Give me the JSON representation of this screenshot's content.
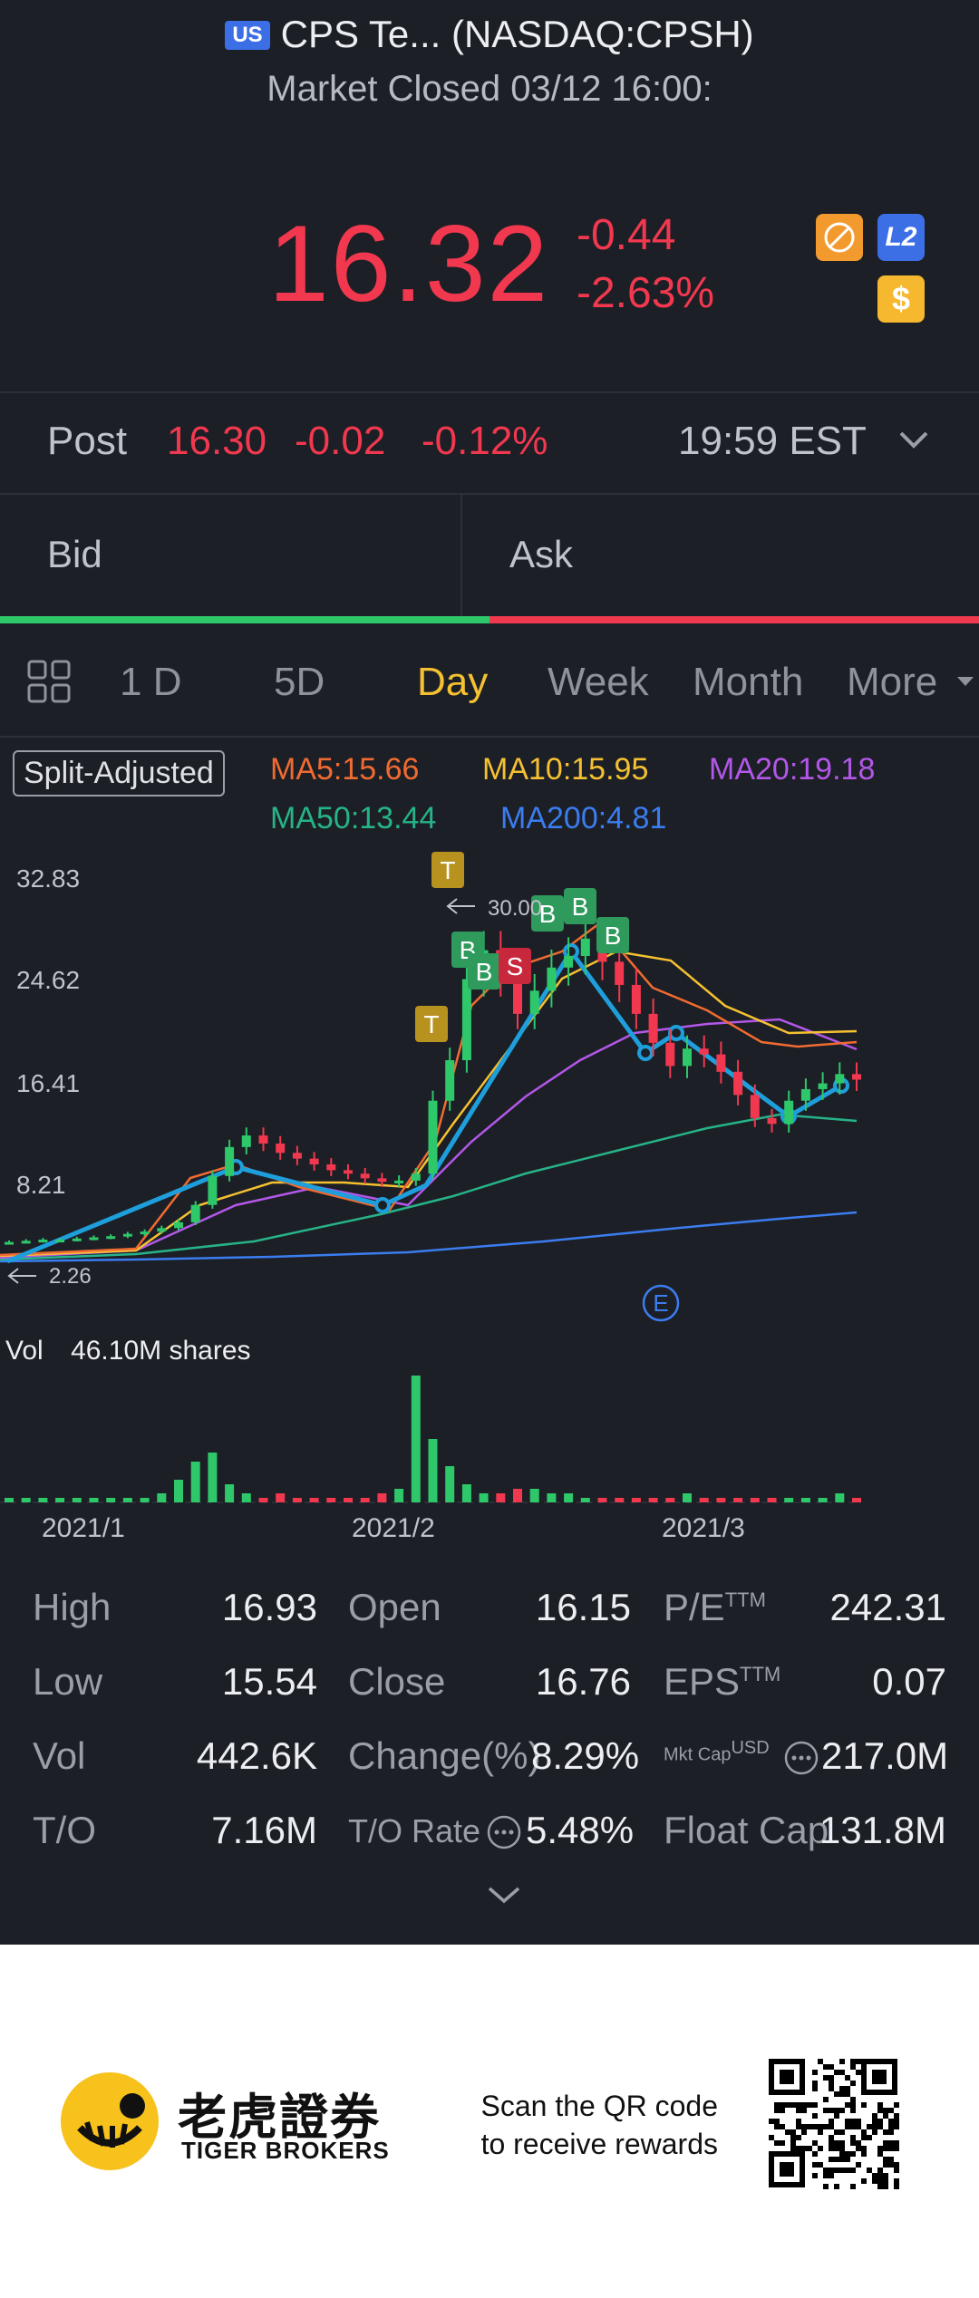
{
  "header": {
    "market_badge": "US",
    "title": "CPS Te... (NASDAQ:CPSH)",
    "status": "Market Closed 03/12 16:00:"
  },
  "quote": {
    "price": "16.32",
    "change": "-0.44",
    "change_pct": "-2.63%",
    "badge_l2": "L2",
    "badge_dollar": "$"
  },
  "post": {
    "label": "Post",
    "price": "16.30",
    "change": "-0.02",
    "change_pct": "-0.12%",
    "time": "19:59 EST"
  },
  "orderbook": {
    "bid": "Bid",
    "ask": "Ask"
  },
  "tabs": [
    "1 D",
    "5D",
    "Day",
    "Week",
    "Month",
    "More"
  ],
  "active_tab": "Day",
  "chart": {
    "adjust_label": "Split-Adjusted",
    "ma5": "MA5:15.66",
    "ma10": "MA10:15.95",
    "ma20": "MA20:19.18",
    "ma50": "MA50:13.44",
    "ma200": "MA200:4.81",
    "y_labels": [
      "32.83",
      "24.62",
      "16.41",
      "8.21"
    ],
    "low_marker": "2.26",
    "high_marker": "30.00",
    "earnings_marker": "E",
    "volume_label": "Vol",
    "volume_value": "46.10M shares",
    "x_labels": [
      "2021/1",
      "2021/2",
      "2021/3"
    ],
    "colors": {
      "up": "#2ec86b",
      "down": "#f2384f",
      "ma5": "#f06b31",
      "ma10": "#f5c131",
      "ma20": "#b357e8",
      "ma50": "#26b38a",
      "ma200": "#3b7df0",
      "trend": "#1e9fdc"
    }
  },
  "chart_data": {
    "type": "candlestick",
    "price_series_approx": [
      2.3,
      2.4,
      2.5,
      2.5,
      2.6,
      2.7,
      2.8,
      3.0,
      3.2,
      3.5,
      4.0,
      5.5,
      8.0,
      10.5,
      11.5,
      10.8,
      10.0,
      9.5,
      9.0,
      8.5,
      8.2,
      7.8,
      7.5,
      7.6,
      8.2,
      14.5,
      18.0,
      25.0,
      27.5,
      25.0,
      22.0,
      24.0,
      26.0,
      27.0,
      28.5,
      26.5,
      24.5,
      22.0,
      19.5,
      17.5,
      19.0,
      18.5,
      17.0,
      15.0,
      13.0,
      12.5,
      14.5,
      15.5,
      16.0,
      16.8,
      16.32
    ],
    "volume_series_approx": [
      1,
      1,
      1,
      1,
      1,
      1,
      1,
      1,
      1,
      2,
      5,
      9,
      11,
      4,
      2,
      1,
      2,
      1,
      1,
      1,
      1,
      1,
      2,
      3,
      28,
      14,
      8,
      4,
      2,
      2,
      3,
      3,
      2,
      2,
      1,
      1,
      1,
      1,
      1,
      1,
      2,
      1,
      1,
      1,
      1,
      1,
      1,
      1,
      1,
      2,
      1
    ]
  },
  "stats": [
    {
      "label": "High",
      "value": "16.93"
    },
    {
      "label": "Open",
      "value": "16.15"
    },
    {
      "label": "P/E",
      "sup": "TTM",
      "value": "242.31"
    },
    {
      "label": "Low",
      "value": "15.54"
    },
    {
      "label": "Close",
      "value": "16.76"
    },
    {
      "label": "EPS",
      "sup": "TTM",
      "value": "0.07"
    },
    {
      "label": "Vol",
      "value": "442.6K"
    },
    {
      "label": "Change(%)",
      "value": "8.29%"
    },
    {
      "label": "Mkt Cap",
      "sup": "USD",
      "value": "217.0M"
    },
    {
      "label": "T/O",
      "value": "7.16M"
    },
    {
      "label": "T/O Rate",
      "value": "5.48%"
    },
    {
      "label": "Float Cap",
      "value": "131.8M"
    }
  ],
  "footer": {
    "brand_cn": "老虎證券",
    "brand_en": "TIGER BROKERS",
    "promo_line1": "Scan the QR code",
    "promo_line2": "to receive rewards"
  }
}
